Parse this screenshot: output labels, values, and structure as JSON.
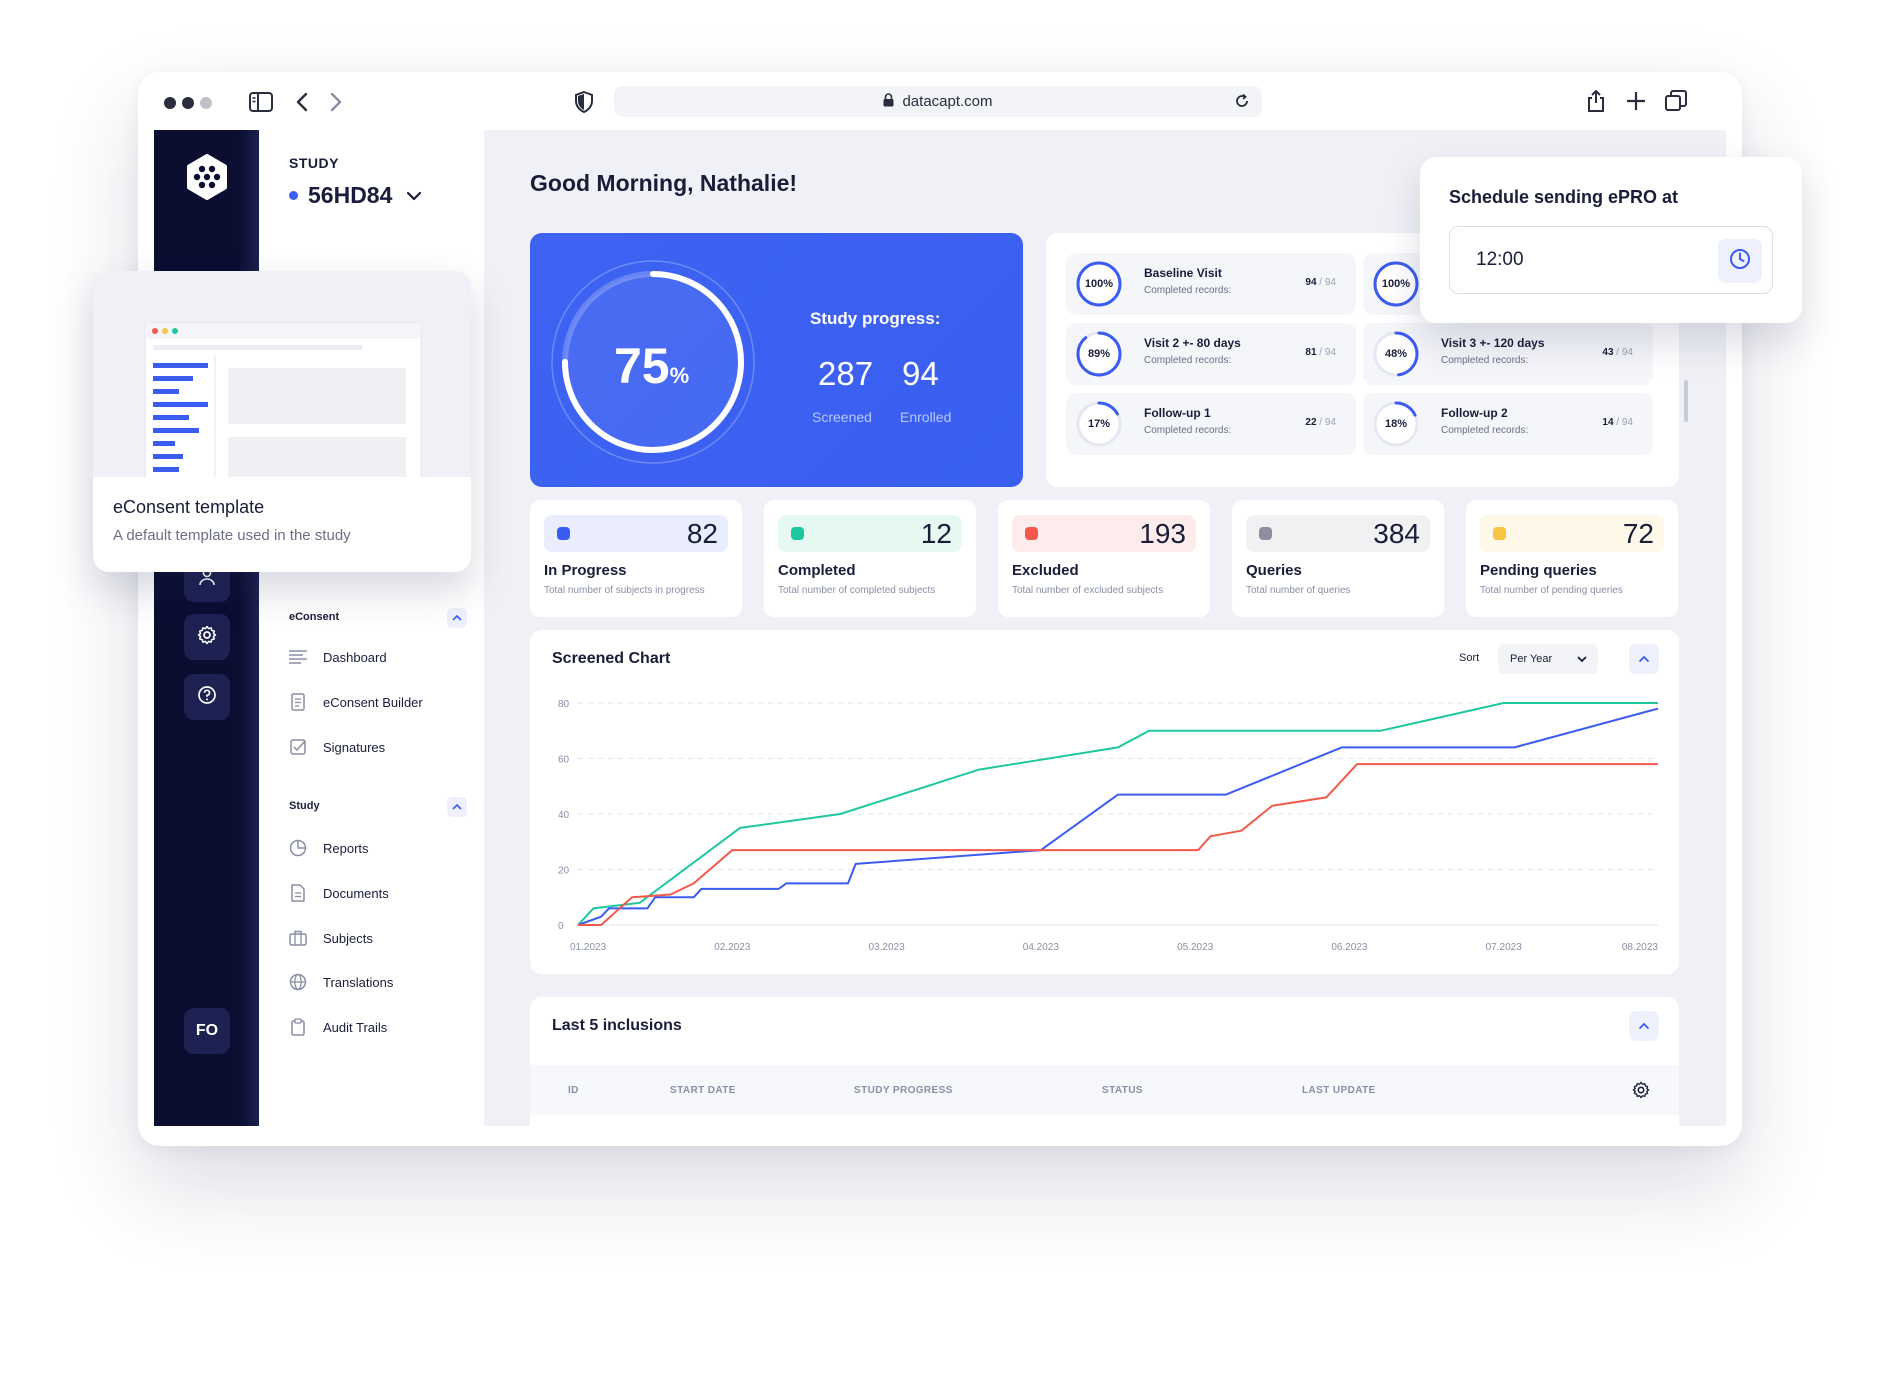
{
  "browser": {
    "url": "datacapt.com"
  },
  "rail": {
    "avatar_initials": "FO"
  },
  "nav": {
    "study_label": "STUDY",
    "study_id": "56HD84",
    "sections": [
      {
        "title": "eConsent",
        "items": [
          {
            "label": "Dashboard",
            "icon": "list-icon"
          },
          {
            "label": "eConsent Builder",
            "icon": "document-icon"
          },
          {
            "label": "Signatures",
            "icon": "checkbox-icon"
          }
        ]
      },
      {
        "title": "Study",
        "items": [
          {
            "label": "Reports",
            "icon": "pie-chart-icon"
          },
          {
            "label": "Documents",
            "icon": "file-icon"
          },
          {
            "label": "Subjects",
            "icon": "briefcase-icon"
          },
          {
            "label": "Translations",
            "icon": "globe-icon"
          },
          {
            "label": "Audit Trails",
            "icon": "clipboard-icon"
          }
        ]
      }
    ]
  },
  "main": {
    "greeting": "Good Morning, Nathalie!",
    "progress": {
      "percent": 75,
      "percent_value": "75",
      "percent_sign": "%",
      "title": "Study progress:",
      "screened": "287",
      "screened_label": "Screened",
      "enrolled": "94",
      "enrolled_label": "Enrolled"
    },
    "visits": [
      {
        "pct": "100%",
        "fraction": 1.0,
        "name": "Baseline Visit",
        "sub": "Completed records:",
        "done": "94",
        "total": "94"
      },
      {
        "pct": "100%",
        "fraction": 1.0,
        "name": "",
        "sub": "",
        "done": "",
        "total": ""
      },
      {
        "pct": "89%",
        "fraction": 0.89,
        "name": "Visit 2 +- 80 days",
        "sub": "Completed records:",
        "done": "81",
        "total": "94"
      },
      {
        "pct": "48%",
        "fraction": 0.48,
        "name": "Visit 3 +- 120 days",
        "sub": "Completed records:",
        "done": "43",
        "total": "94"
      },
      {
        "pct": "17%",
        "fraction": 0.17,
        "name": "Follow-up 1",
        "sub": "Completed records:",
        "done": "22",
        "total": "94"
      },
      {
        "pct": "18%",
        "fraction": 0.18,
        "name": "Follow-up 2",
        "sub": "Completed records:",
        "done": "14",
        "total": "94"
      }
    ],
    "stats": [
      {
        "value": "82",
        "label": "In Progress",
        "sub": "Total number of subjects in progress",
        "color": "#3b5cf0",
        "band": "#e9edfd"
      },
      {
        "value": "12",
        "label": "Completed",
        "sub": "Total number of completed subjects",
        "color": "#1fc7a1",
        "band": "#e5f8f2"
      },
      {
        "value": "193",
        "label": "Excluded",
        "sub": "Total number of excluded subjects",
        "color": "#f2594b",
        "band": "#fdeceb"
      },
      {
        "value": "384",
        "label": "Queries",
        "sub": "Total number of queries",
        "color": "#8e90a2",
        "band": "#f1f1f4"
      },
      {
        "value": "72",
        "label": "Pending queries",
        "sub": "Total number of pending queries",
        "color": "#f6c544",
        "band": "#fdf8e7"
      }
    ],
    "chart": {
      "title": "Screened Chart",
      "sort_label": "Sort",
      "sort_value": "Per Year"
    },
    "inclusions": {
      "title": "Last 5 inclusions",
      "columns": [
        "ID",
        "START DATE",
        "STUDY PROGRESS",
        "STATUS",
        "LAST UPDATE"
      ]
    }
  },
  "template_popover": {
    "title": "eConsent template",
    "subtitle": "A default template used in the study"
  },
  "epro_popover": {
    "title": "Schedule sending ePRO at",
    "time": "12:00"
  },
  "chart_data": {
    "type": "line",
    "x": [
      "01.2023",
      "02.2023",
      "03.2023",
      "04.2023",
      "05.2023",
      "06.2023",
      "07.2023",
      "08.2023"
    ],
    "ylim": [
      0,
      80
    ],
    "yticks": [
      0,
      20,
      40,
      60,
      80
    ],
    "grid": true,
    "series": [
      {
        "color": "#1fc7a1",
        "points": [
          [
            0,
            0
          ],
          [
            0.1,
            6
          ],
          [
            0.4,
            8
          ],
          [
            1.05,
            35
          ],
          [
            1.7,
            40
          ],
          [
            2.6,
            56
          ],
          [
            3.5,
            64
          ],
          [
            3.7,
            70
          ],
          [
            5.2,
            70
          ],
          [
            6,
            80
          ],
          [
            7,
            80
          ]
        ]
      },
      {
        "color": "#3b5cf0",
        "points": [
          [
            0,
            0
          ],
          [
            0.15,
            3
          ],
          [
            0.2,
            6
          ],
          [
            0.45,
            6
          ],
          [
            0.5,
            10
          ],
          [
            0.75,
            10
          ],
          [
            0.8,
            13
          ],
          [
            1.3,
            13
          ],
          [
            1.35,
            15
          ],
          [
            1.75,
            15
          ],
          [
            1.8,
            22
          ],
          [
            3,
            27
          ],
          [
            3.5,
            47
          ],
          [
            4.2,
            47
          ],
          [
            4.95,
            64
          ],
          [
            6.07,
            64
          ],
          [
            7,
            78
          ]
        ]
      },
      {
        "color": "#f2594b",
        "points": [
          [
            0,
            0
          ],
          [
            0.15,
            0
          ],
          [
            0.35,
            10
          ],
          [
            0.6,
            11
          ],
          [
            0.75,
            15
          ],
          [
            1,
            27
          ],
          [
            4.02,
            27
          ],
          [
            4.1,
            32
          ],
          [
            4.3,
            34
          ],
          [
            4.5,
            43
          ],
          [
            4.85,
            46
          ],
          [
            5.05,
            58
          ],
          [
            7,
            58
          ]
        ]
      }
    ]
  }
}
